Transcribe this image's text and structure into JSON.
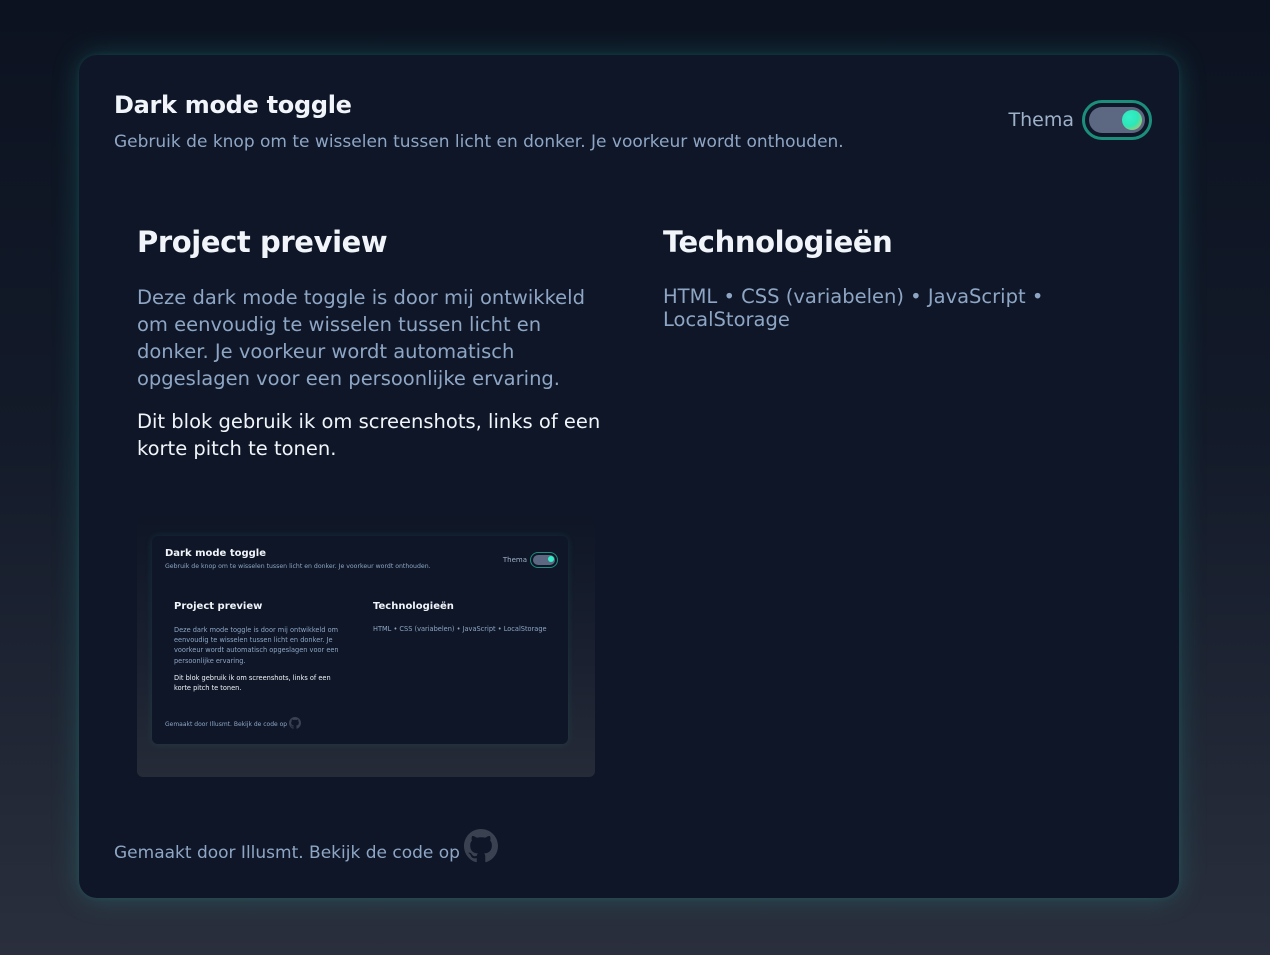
{
  "header": {
    "title": "Dark mode toggle",
    "subtitle": "Gebruik de knop om te wisselen tussen licht en donker. Je voorkeur wordt onthouden.",
    "theme_label": "Thema",
    "toggle_state": "dark"
  },
  "project": {
    "title": "Project preview",
    "paragraph1": "Deze dark mode toggle is door mij ontwikkeld om eenvoudig te wisselen tussen licht en donker. Je voorkeur wordt automatisch opgeslagen voor een persoonlijke ervaring.",
    "paragraph2": "Dit blok gebruik ik om screenshots, links of een korte pitch te tonen."
  },
  "tech": {
    "title": "Technologieën",
    "list": "HTML • CSS (variabelen) • JavaScript • LocalStorage"
  },
  "preview": {
    "title": "Dark mode toggle",
    "subtitle": "Gebruik de knop om te wisselen tussen licht en donker. Je voorkeur wordt onthouden.",
    "theme_label": "Thema",
    "project_title": "Project preview",
    "project_paragraph1": "Deze dark mode toggle is door mij ontwikkeld om eenvoudig te wisselen tussen licht en donker. Je voorkeur wordt automatisch opgeslagen voor een persoonlijke ervaring.",
    "project_paragraph2": "Dit blok gebruik ik om screenshots, links of een korte pitch te tonen.",
    "tech_title": "Technologieën",
    "tech_list": "HTML • CSS (variabelen) • JavaScript • LocalStorage",
    "footer_text": "Gemaakt door Illusmt. Bekijk de code op"
  },
  "footer": {
    "text": "Gemaakt door Illusmt. Bekijk de code op",
    "icon": "github-icon"
  },
  "colors": {
    "accent": "#2dd4bf",
    "card_bg": "#0e1628",
    "text_primary": "#f1f5f9",
    "text_muted": "#8ea6c4"
  }
}
